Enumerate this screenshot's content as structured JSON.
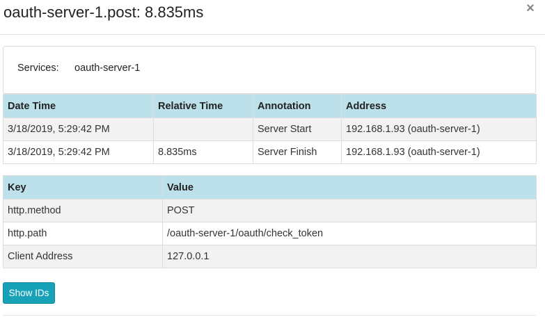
{
  "modal": {
    "title": "oauth-server-1.post: 8.835ms",
    "close_glyph": "×"
  },
  "services": {
    "label": "Services:",
    "value": "oauth-server-1"
  },
  "annotations": {
    "headers": [
      "Date Time",
      "Relative Time",
      "Annotation",
      "Address"
    ],
    "rows": [
      [
        "3/18/2019, 5:29:42 PM",
        "",
        "Server Start",
        "192.168.1.93 (oauth-server-1)"
      ],
      [
        "3/18/2019, 5:29:42 PM",
        "8.835ms",
        "Server Finish",
        "192.168.1.93 (oauth-server-1)"
      ]
    ]
  },
  "tags": {
    "headers": [
      "Key",
      "Value"
    ],
    "rows": [
      [
        "http.method",
        "POST"
      ],
      [
        "http.path",
        "/oauth-server-1/oauth/check_token"
      ],
      [
        "Client Address",
        "127.0.0.1"
      ]
    ]
  },
  "show_ids_button": "Show IDs",
  "colors": {
    "header_bg": "#bce1ea",
    "button_bg": "#17a2b8",
    "row_alt_bg": "#f2f2f2"
  }
}
